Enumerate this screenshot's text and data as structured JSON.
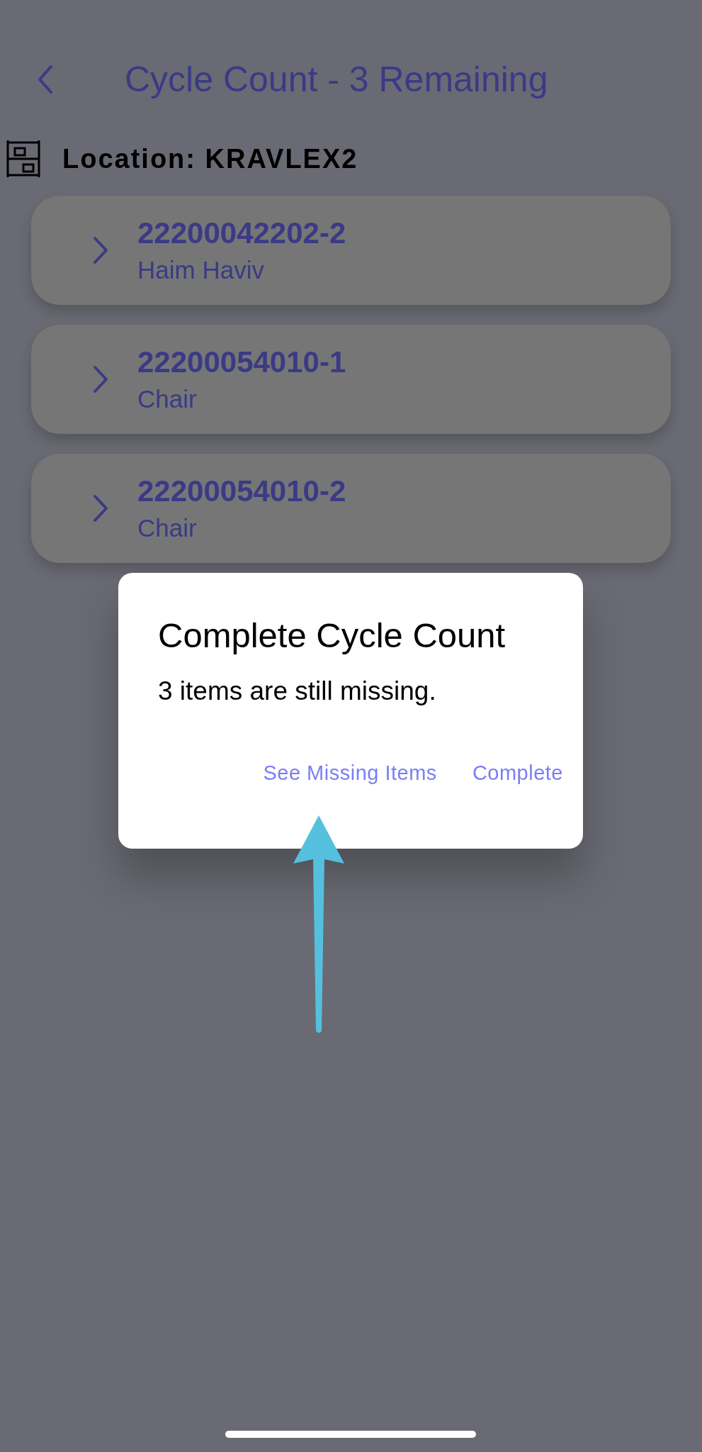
{
  "header": {
    "title": "Cycle Count - 3 Remaining"
  },
  "location": {
    "label": "Location: KRAVLEX2"
  },
  "items": [
    {
      "number": "22200042202-2",
      "description": "Haim Haviv"
    },
    {
      "number": "22200054010-1",
      "description": "Chair"
    },
    {
      "number": "22200054010-2",
      "description": "Chair"
    }
  ],
  "dialog": {
    "title": "Complete Cycle Count",
    "message": "3 items are still missing.",
    "buttons": [
      "See Missing Items",
      "Complete"
    ]
  }
}
